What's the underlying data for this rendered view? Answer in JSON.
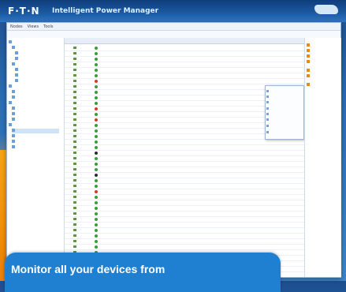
{
  "header": {
    "logo": "F·T·N",
    "app_title": "Intelligent Power Manager"
  },
  "menubar": {
    "items": [
      "Nodes",
      "Views",
      "Tools"
    ]
  },
  "caption": {
    "text": "Monitor all your devices from"
  },
  "colors": {
    "accent_blue": "#1f7fd0",
    "orange": "#f28c06",
    "status_green": "#3a9d3a",
    "status_red": "#d33b2c"
  }
}
